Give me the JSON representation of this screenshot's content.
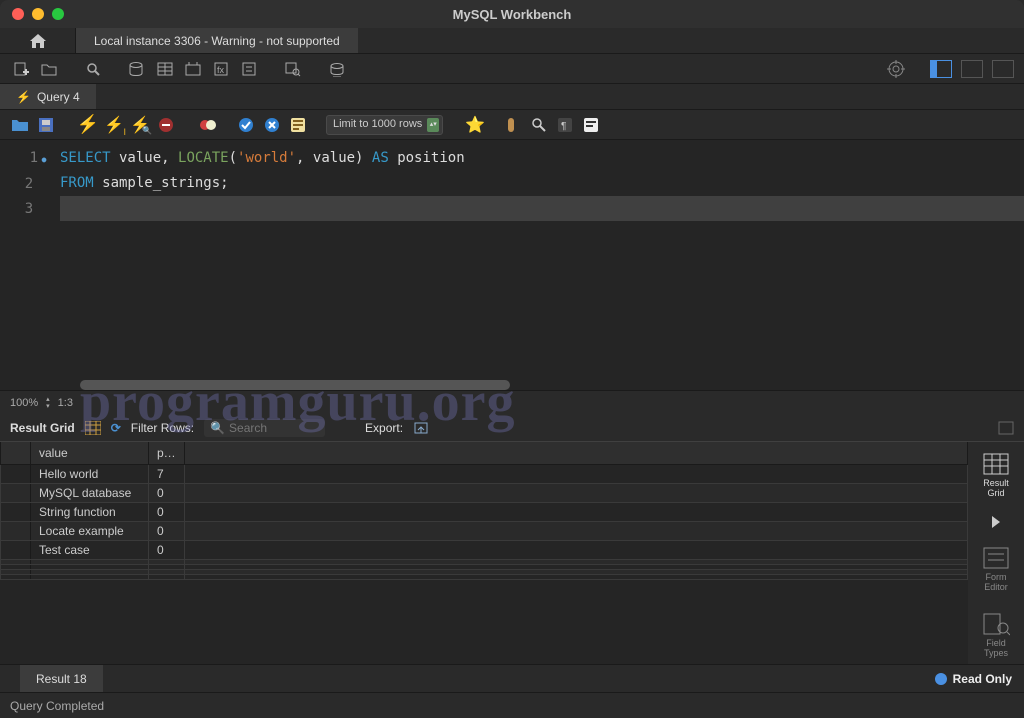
{
  "window": {
    "title": "MySQL Workbench"
  },
  "connection_tab": "Local instance 3306 - Warning - not supported",
  "query_tab": {
    "label": "Query 4"
  },
  "editor_toolbar": {
    "limit_label": "Limit to 1000 rows"
  },
  "code": {
    "line1": {
      "kw1": "SELECT",
      "c1": " value, ",
      "fn": "LOCATE",
      "c2": "(",
      "str": "'world'",
      "c3": ", value) ",
      "kw2": "AS",
      "c4": " position"
    },
    "line2": {
      "kw1": "FROM",
      "c1": " sample_strings;"
    }
  },
  "zoom": {
    "percent": "100%",
    "cursor": "1:3"
  },
  "result_toolbar": {
    "label": "Result Grid",
    "filter_label": "Filter Rows:",
    "search_placeholder": "Search",
    "export_label": "Export:"
  },
  "grid": {
    "headers": {
      "col1": "value",
      "col2": "p…"
    },
    "rows": [
      {
        "value": "Hello world",
        "pos": "7"
      },
      {
        "value": "MySQL database",
        "pos": "0"
      },
      {
        "value": "String function",
        "pos": "0"
      },
      {
        "value": "Locate example",
        "pos": "0"
      },
      {
        "value": "Test case",
        "pos": "0"
      }
    ]
  },
  "side_panel": {
    "result_grid": "Result Grid",
    "form_editor": "Form Editor",
    "field_types": "Field Types"
  },
  "result_tab": "Result 18",
  "read_only": "Read Only",
  "status": "Query Completed",
  "watermark": "programguru.org"
}
